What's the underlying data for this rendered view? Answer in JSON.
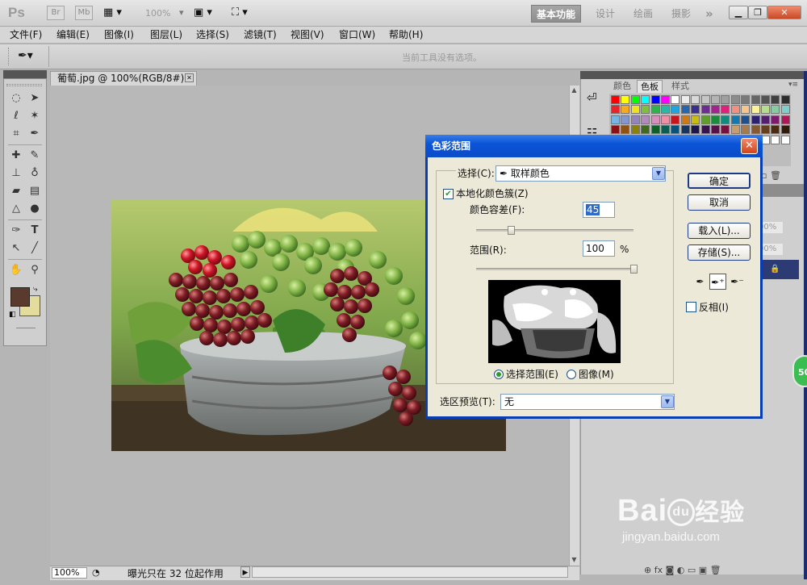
{
  "appbar": {
    "logo": "Ps",
    "br_label": "Br",
    "mb_label": "Mb",
    "zoom": "100%",
    "workspaces": [
      "基本功能",
      "设计",
      "绘画",
      "摄影"
    ],
    "more": "»"
  },
  "menu": [
    "文件(F)",
    "编辑(E)",
    "图像(I)",
    "图层(L)",
    "选择(S)",
    "滤镜(T)",
    "视图(V)",
    "窗口(W)",
    "帮助(H)"
  ],
  "options": {
    "hint": "当前工具没有选项。"
  },
  "document": {
    "tab_title": "葡萄.jpg @ 100%(RGB/8#)",
    "zoom": "100%",
    "status": "曝光只在 32 位起作用"
  },
  "panels": {
    "tabs": [
      "颜色",
      "色板",
      "样式"
    ],
    "active_tab": "色板",
    "opacity_1": "00%",
    "opacity_2": "00%",
    "badge": "50"
  },
  "dialog": {
    "title": "色彩范围",
    "select_label": "选择(C):",
    "select_value": "取样颜色",
    "localized_label": "本地化颜色簇(Z)",
    "localized_checked": true,
    "fuzziness_label": "颜色容差(F):",
    "fuzziness_value": "45",
    "fuzziness_level": 0.22,
    "range_label": "范围(R):",
    "range_value": "100",
    "range_unit": "%",
    "range_level": 1.0,
    "preview_mode_selection": "选择范围(E)",
    "preview_mode_image": "图像(M)",
    "preview_mode_selected": "selection",
    "selection_preview_label": "选区预览(T):",
    "selection_preview_value": "无",
    "buttons": {
      "ok": "确定",
      "cancel": "取消",
      "load": "载入(L)...",
      "save": "存储(S)..."
    },
    "invert_label": "反相(I)",
    "invert_checked": false
  },
  "watermark": {
    "brand": "Bai",
    "paw_text": "du",
    "cn": "经验",
    "url": "jingyan.baidu.com"
  },
  "colors": {
    "title_bar": "#0b54d8",
    "dialog_bg": "#ece9d8",
    "foreground_swatch": "#5b3a2e",
    "background_swatch": "#e3dc9c"
  }
}
